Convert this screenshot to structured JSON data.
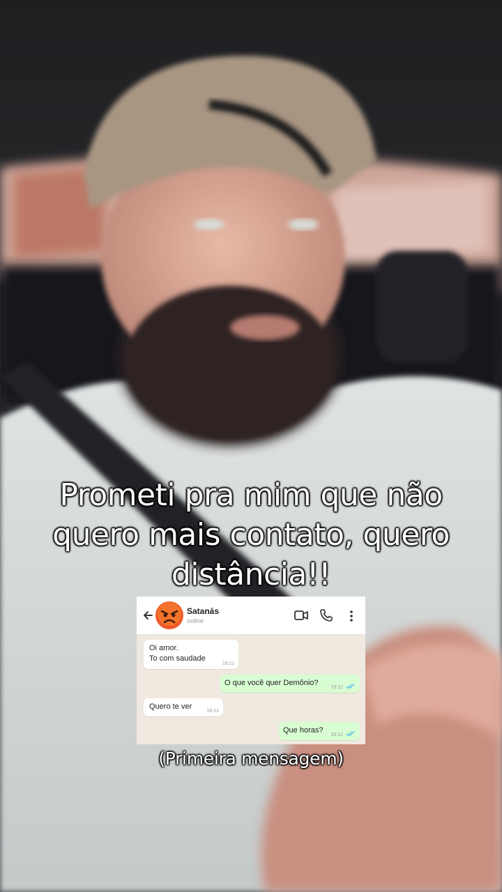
{
  "captions": {
    "main_lines": [
      "Prometi pra mim que não",
      "quero mais contato, quero",
      "distância!!"
    ],
    "sub": "(Primeira mensagem)"
  },
  "chat": {
    "contact_name": "Satanás",
    "contact_status": "online",
    "avatar_emoji": "angry-face",
    "header_icons": [
      "back-arrow-icon",
      "video-call-icon",
      "phone-icon",
      "more-vert-icon"
    ],
    "messages": [
      {
        "direction": "in",
        "lines": [
          "Oi amor.",
          "To com saudade"
        ],
        "time": "16:11"
      },
      {
        "direction": "out",
        "lines": [
          "O que você quer Demônio?"
        ],
        "time": "16:12",
        "read": true
      },
      {
        "direction": "in",
        "lines": [
          "Quero te ver"
        ],
        "time": "16:12"
      },
      {
        "direction": "out",
        "lines": [
          "Que horas?"
        ],
        "time": "16:12",
        "read": true
      }
    ],
    "colors": {
      "incoming": "#ffffff",
      "outgoing": "#d9fdd3",
      "background": "#efe9df",
      "read_ticks": "#53bdeb"
    }
  }
}
